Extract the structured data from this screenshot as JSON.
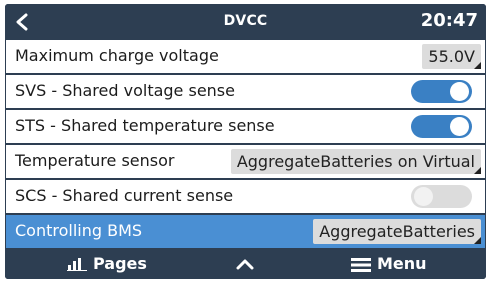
{
  "header": {
    "title": "DVCC",
    "time": "20:47"
  },
  "settings": [
    {
      "label": "Maximum charge voltage",
      "type": "value",
      "value": "55.0V"
    },
    {
      "label": "SVS - Shared voltage sense",
      "type": "toggle",
      "enabled": true
    },
    {
      "label": "STS - Shared temperature sense",
      "type": "toggle",
      "enabled": true
    },
    {
      "label": "Temperature sensor",
      "type": "value",
      "value": "AggregateBatteries on Virtual"
    },
    {
      "label": "SCS - Shared current sense",
      "type": "toggle",
      "enabled": false
    },
    {
      "label": "Controlling BMS",
      "type": "value",
      "value": "AggregateBatteries",
      "selected": true
    }
  ],
  "footer": {
    "pages_label": "Pages",
    "menu_label": "Menu"
  },
  "colors": {
    "header_bg": "#2d3e52",
    "selected_row": "#4a8fd3",
    "toggle_on": "#3a80c4",
    "toggle_off": "#dcdcdc"
  }
}
